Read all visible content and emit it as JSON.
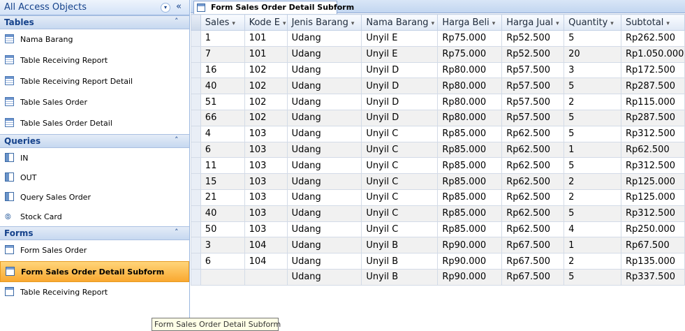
{
  "nav": {
    "title": "All Access Objects",
    "menu_icon": "dropdown-circle-icon",
    "collapse_label": "«",
    "groups": [
      {
        "title": "Tables",
        "chevron": "≈",
        "items": [
          {
            "label": "Nama Barang",
            "icon": "table-icon"
          },
          {
            "label": "Table Receiving Report",
            "icon": "table-icon"
          },
          {
            "label": "Table Receiving Report Detail",
            "icon": "table-icon"
          },
          {
            "label": "Table Sales Order",
            "icon": "table-icon"
          },
          {
            "label": "Table Sales Order Detail",
            "icon": "table-icon"
          }
        ]
      },
      {
        "title": "Queries",
        "chevron": "≈",
        "items": [
          {
            "label": "IN",
            "icon": "query-icon"
          },
          {
            "label": "OUT",
            "icon": "query-icon"
          },
          {
            "label": "Query Sales Order",
            "icon": "query-icon"
          },
          {
            "label": "Stock Card",
            "icon": "union-query-icon"
          }
        ]
      },
      {
        "title": "Forms",
        "chevron": "≈",
        "items": [
          {
            "label": "Form Sales Order",
            "icon": "form-icon"
          },
          {
            "label": "Form Sales Order Detail Subform",
            "icon": "form-icon",
            "selected": true
          },
          {
            "label": "Table Receiving Report",
            "icon": "form-icon"
          }
        ]
      }
    ]
  },
  "document": {
    "tab_label": "Form Sales Order Detail Subform"
  },
  "datasheet": {
    "columns": [
      "Sales",
      "Kode E",
      "Jenis Barang",
      "Nama Barang",
      "Harga Beli",
      "Harga Jual",
      "Quantity",
      "Subtotal"
    ],
    "rows": [
      [
        "1",
        "101",
        "Udang",
        "Unyil E",
        "Rp75.000",
        "Rp52.500",
        "5",
        "Rp262.500"
      ],
      [
        "7",
        "101",
        "Udang",
        "Unyil E",
        "Rp75.000",
        "Rp52.500",
        "20",
        "Rp1.050.000"
      ],
      [
        "16",
        "102",
        "Udang",
        "Unyil D",
        "Rp80.000",
        "Rp57.500",
        "3",
        "Rp172.500"
      ],
      [
        "40",
        "102",
        "Udang",
        "Unyil D",
        "Rp80.000",
        "Rp57.500",
        "5",
        "Rp287.500"
      ],
      [
        "51",
        "102",
        "Udang",
        "Unyil D",
        "Rp80.000",
        "Rp57.500",
        "2",
        "Rp115.000"
      ],
      [
        "66",
        "102",
        "Udang",
        "Unyil D",
        "Rp80.000",
        "Rp57.500",
        "5",
        "Rp287.500"
      ],
      [
        "4",
        "103",
        "Udang",
        "Unyil C",
        "Rp85.000",
        "Rp62.500",
        "5",
        "Rp312.500"
      ],
      [
        "6",
        "103",
        "Udang",
        "Unyil C",
        "Rp85.000",
        "Rp62.500",
        "1",
        "Rp62.500"
      ],
      [
        "11",
        "103",
        "Udang",
        "Unyil C",
        "Rp85.000",
        "Rp62.500",
        "5",
        "Rp312.500"
      ],
      [
        "15",
        "103",
        "Udang",
        "Unyil C",
        "Rp85.000",
        "Rp62.500",
        "2",
        "Rp125.000"
      ],
      [
        "21",
        "103",
        "Udang",
        "Unyil C",
        "Rp85.000",
        "Rp62.500",
        "2",
        "Rp125.000"
      ],
      [
        "40",
        "103",
        "Udang",
        "Unyil C",
        "Rp85.000",
        "Rp62.500",
        "5",
        "Rp312.500"
      ],
      [
        "50",
        "103",
        "Udang",
        "Unyil C",
        "Rp85.000",
        "Rp62.500",
        "4",
        "Rp250.000"
      ],
      [
        "3",
        "104",
        "Udang",
        "Unyil B",
        "Rp90.000",
        "Rp67.500",
        "1",
        "Rp67.500"
      ],
      [
        "6",
        "104",
        "Udang",
        "Unyil B",
        "Rp90.000",
        "Rp67.500",
        "2",
        "Rp135.000"
      ],
      [
        "",
        "",
        "Udang",
        "Unyil B",
        "Rp90.000",
        "Rp67.500",
        "5",
        "Rp337.500"
      ]
    ]
  },
  "tooltip": "Form Sales Order Detail Subform",
  "colors": {
    "accent": "#15428b",
    "selected_item": "#f9a830",
    "tooltip_bg": "#ffffe6"
  }
}
